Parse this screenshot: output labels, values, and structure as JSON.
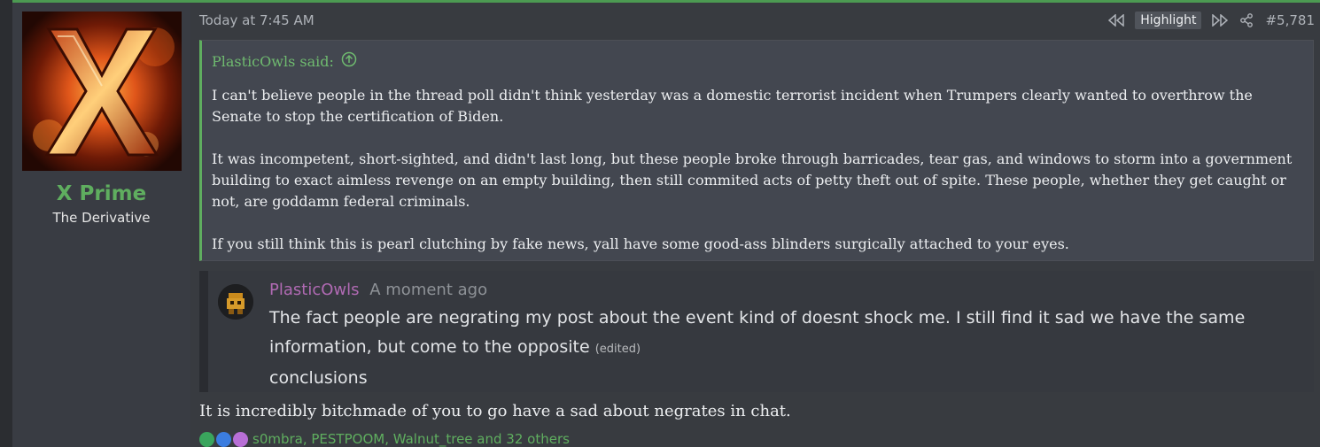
{
  "user": {
    "name": "X Prime",
    "title": "The Derivative"
  },
  "post": {
    "timestamp": "Today at 7:45 AM",
    "highlight_label": "Highlight",
    "post_number": "#5,781",
    "quote": {
      "author_said": "PlasticOwls said:",
      "paragraphs": [
        "I can't believe people in the thread poll didn't think yesterday was a domestic terrorist incident when Trumpers clearly wanted to overthrow the Senate to stop the certification of Biden.",
        "It was incompetent, short-sighted, and didn't last long, but these people broke through barricades, tear gas, and windows to storm into a government building to exact aimless revenge on an empty building, then still commited acts of petty theft out of spite. These people, whether they get caught or not, are goddamn federal criminals.",
        "If you still think this is pearl clutching by fake news, yall have some good-ass blinders surgically attached to your eyes."
      ]
    },
    "embed": {
      "author": "PlasticOwls",
      "time": "A moment ago",
      "line1": "The fact people are negrating my post about the event kind of doesnt shock me. I still find it sad we have the same",
      "line2": "information, but come to the opposite",
      "edited": "(edited)",
      "line3": "conclusions"
    },
    "reply_text": "It is incredibly bitchmade of you to go have a sad about negrates in chat.",
    "reactions_text": "s0mbra, PESTPOOM, Walnut_tree and 32 others"
  },
  "colors": {
    "accent_green": "#5fae5f",
    "discord_author": "#b06ab3",
    "background": "#383b40"
  }
}
